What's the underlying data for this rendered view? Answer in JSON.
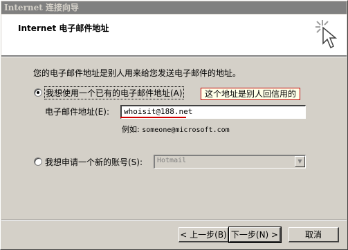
{
  "window": {
    "title": "Internet 连接向导"
  },
  "header": {
    "title": "Internet 电子邮件地址",
    "icon": "wizard-sparkle-cursor-icon"
  },
  "intro_text": "您的电子邮件地址是别人用来给您发送电子邮件的地址。",
  "option_existing": {
    "label": "我想使用一个已有的电子邮件地址(A)",
    "selected": true
  },
  "annotation": {
    "text": "这个地址是别人回信用的",
    "color": "#c00000"
  },
  "email_field": {
    "label": "电子邮件地址(E):",
    "value": "whoisit@188.net"
  },
  "example": {
    "prefix": "例如:",
    "address": "someone@microsoft.com"
  },
  "option_new": {
    "label": "我想申请一个新的账号(S):",
    "selected": false
  },
  "provider_select": {
    "value": "Hotmail",
    "enabled": false
  },
  "buttons": {
    "back": "< 上一步(B)",
    "next": "下一步(N) >",
    "cancel": "取消"
  }
}
